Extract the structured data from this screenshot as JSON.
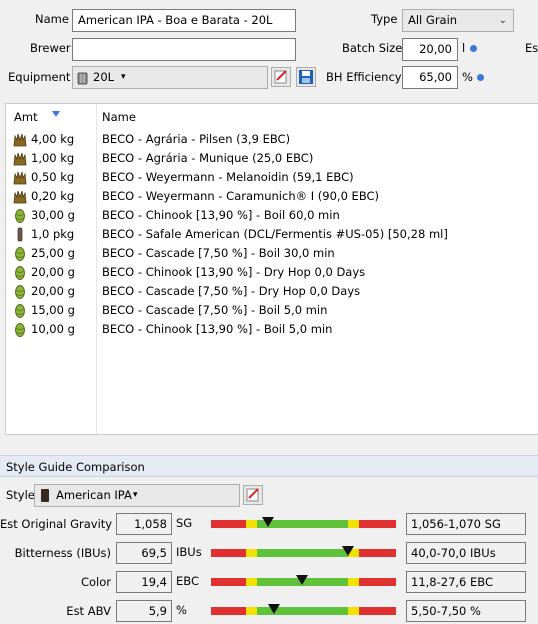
{
  "header": {
    "name_label": "Name",
    "name_value": "American IPA - Boa e Barata - 20L",
    "type_label": "Type",
    "type_value": "All Grain",
    "brewer_label": "Brewer",
    "brewer_value": "",
    "batch_size_label": "Batch Size",
    "batch_size_value": "20,00",
    "batch_size_unit": "l",
    "est_label_cut": "Est",
    "equipment_label": "Equipment",
    "equipment_value": "20L",
    "bh_eff_label": "BH Efficiency",
    "bh_eff_value": "65,00",
    "bh_eff_unit": "%"
  },
  "ingredients": {
    "col_amt": "Amt",
    "col_name": "Name",
    "rows": [
      {
        "icon": "grain-icon",
        "amt": "4,00 kg",
        "name": "BECO - Agrária - Pilsen (3,9 EBC)"
      },
      {
        "icon": "grain-icon",
        "amt": "1,00 kg",
        "name": "BECO - Agrária - Munique (25,0 EBC)"
      },
      {
        "icon": "grain-icon",
        "amt": "0,50 kg",
        "name": "BECO - Weyermann - Melanoidin (59,1 EBC)"
      },
      {
        "icon": "grain-icon",
        "amt": "0,20 kg",
        "name": "BECO - Weyermann - Caramunich® I (90,0 EBC)"
      },
      {
        "icon": "hop-icon",
        "amt": "30,00 g",
        "name": "BECO - Chinook [13,90 %] - Boil 60,0 min"
      },
      {
        "icon": "yeast-icon",
        "amt": "1,0 pkg",
        "name": "BECO - Safale American  (DCL/Fermentis #US-05) [50,28 ml]"
      },
      {
        "icon": "hop-icon",
        "amt": "25,00 g",
        "name": "BECO - Cascade [7,50 %] - Boil 30,0 min"
      },
      {
        "icon": "hop-icon",
        "amt": "20,00 g",
        "name": "BECO - Chinook [13,90 %] - Dry Hop 0,0 Days"
      },
      {
        "icon": "hop-icon",
        "amt": "20,00 g",
        "name": "BECO - Cascade [7,50 %] - Dry Hop 0,0 Days"
      },
      {
        "icon": "hop-icon",
        "amt": "15,00 g",
        "name": "BECO - Cascade [7,50 %] - Boil 5,0 min"
      },
      {
        "icon": "hop-icon",
        "amt": "10,00 g",
        "name": "BECO - Chinook [13,90 %] - Boil 5,0 min"
      }
    ]
  },
  "style_guide": {
    "section_title": "Style Guide Comparison",
    "style_label": "Style",
    "style_value": "American IPA",
    "rows": [
      {
        "label": "Est Original Gravity",
        "value": "1,058",
        "unit": "SG",
        "range": "1,056-1,070 SG",
        "marker_fraction": 0.31
      },
      {
        "label": "Bitterness (IBUs)",
        "value": "69,5",
        "unit": "IBUs",
        "range": "40,0-70,0 IBUs",
        "marker_fraction": 0.74
      },
      {
        "label": "Color",
        "value": "19,4",
        "unit": "EBC",
        "range": "11,8-27,6 EBC",
        "marker_fraction": 0.49
      },
      {
        "label": "Est ABV",
        "value": "5,9",
        "unit": "%",
        "range": "5,50-7,50 %",
        "marker_fraction": 0.34
      }
    ]
  },
  "colors": {
    "gauge_red": "#e03131",
    "gauge_yellow": "#f2e200",
    "gauge_green": "#5fc23a",
    "accent_blue": "#3b78d8"
  }
}
